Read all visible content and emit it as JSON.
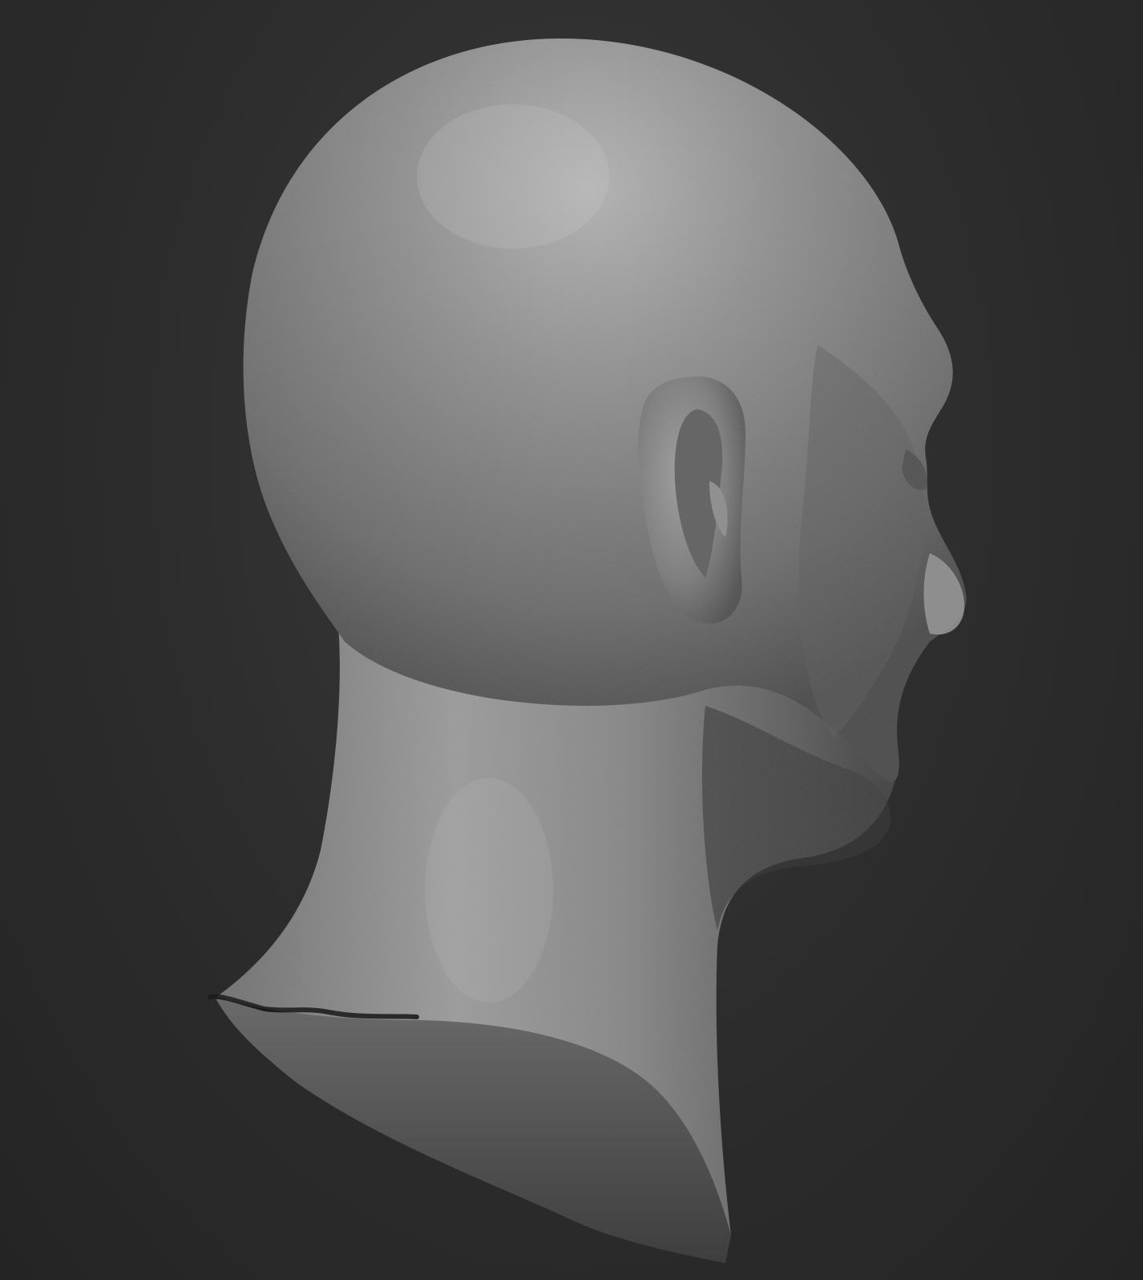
{
  "scene": {
    "subject": "",
    "colors": {
      "background": "#2c2c2c",
      "surface_light": "#a8a8a8",
      "surface_mid": "#7c7c7c",
      "surface_dark": "#4a4a4a",
      "shadow": "#1e1e1e"
    }
  }
}
